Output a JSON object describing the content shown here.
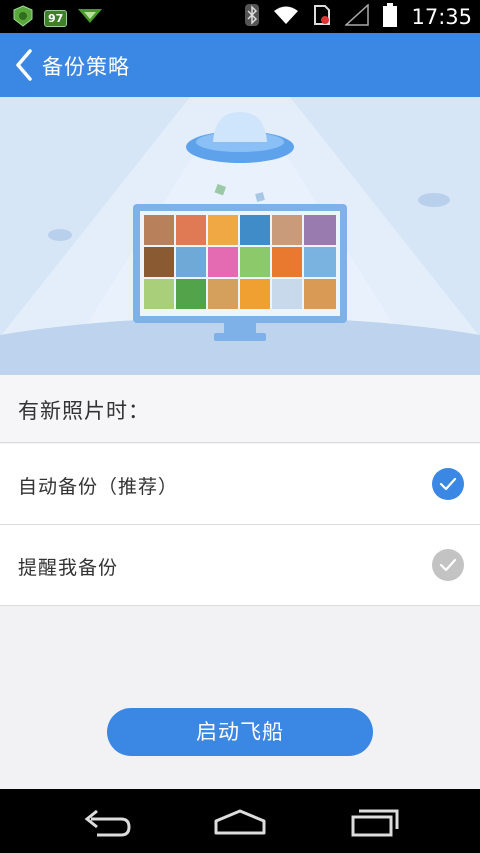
{
  "status_bar": {
    "time": "17:35",
    "battery_badge": "97",
    "icons": [
      "shield-app-icon",
      "battery-badge-icon",
      "download-arrow-icon",
      "bluetooth-icon",
      "wifi-icon",
      "sim-icon",
      "signal-icon",
      "battery-icon"
    ]
  },
  "header": {
    "title": "备份策略"
  },
  "section": {
    "title": "有新照片时："
  },
  "options": [
    {
      "label": "自动备份（推荐）",
      "checked": true
    },
    {
      "label": "提醒我备份",
      "checked": false
    }
  ],
  "launch_button": {
    "label": "启动飞船"
  },
  "colors": {
    "accent": "#3a87e4",
    "check_off": "#c3c3c3",
    "hero_bg": "#d6e6f7"
  },
  "nav_bar": {
    "icons": [
      "back-nav-icon",
      "home-nav-icon",
      "recents-nav-icon"
    ]
  }
}
